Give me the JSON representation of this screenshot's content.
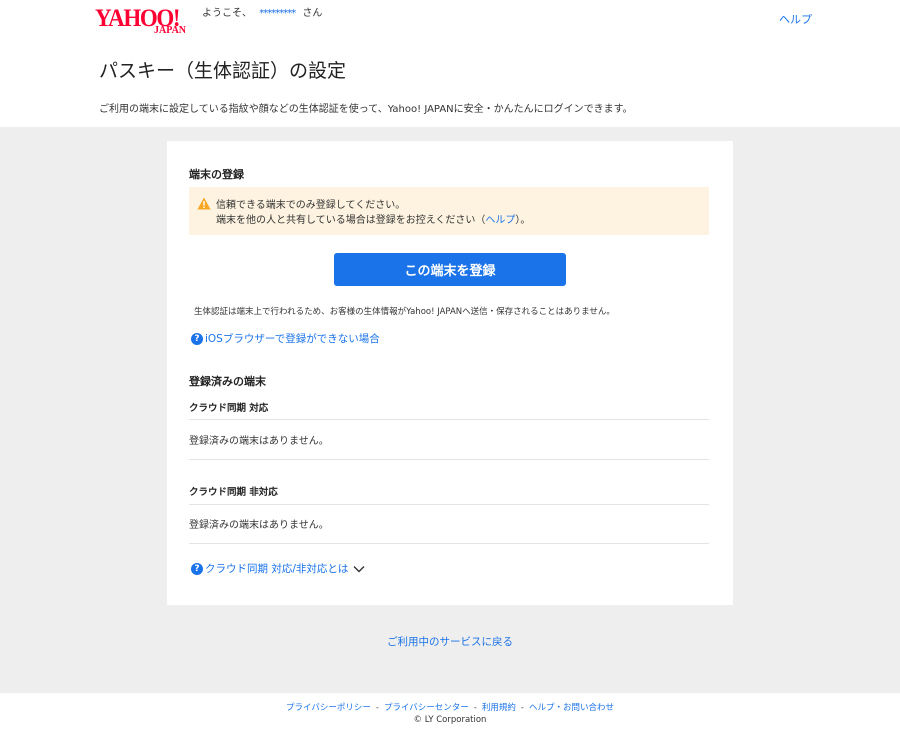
{
  "header": {
    "logo_main": "YAHOO!",
    "logo_sub": "JAPAN",
    "welcome_prefix": "ようこそ、",
    "username": "*********",
    "welcome_suffix": "さん",
    "help": "ヘルプ"
  },
  "page": {
    "title": "パスキー（生体認証）の設定",
    "description": "ご利用の端末に設定している指紋や顔などの生体認証を使って、Yahoo! JAPANに安全・かんたんにログインできます。"
  },
  "register": {
    "heading": "端末の登録",
    "warning_line1": "信頼できる端末でのみ登録してください。",
    "warning_line2_prefix": "端末を他の人と共有している場合は登録をお控えください（",
    "warning_line2_link": "ヘルプ",
    "warning_line2_suffix": "）。",
    "button": "この端末を登録",
    "note": "生体認証は端末上で行われるため、お客様の生体情報がYahoo! JAPANへ送信・保存されることはありません。",
    "ios_link": "iOSブラウザーで登録ができない場合"
  },
  "registered": {
    "heading": "登録済みの端末",
    "sync_heading": "クラウド同期 対応",
    "sync_empty": "登録済みの端末はありません。",
    "nosync_heading": "クラウド同期 非対応",
    "nosync_empty": "登録済みの端末はありません。",
    "about_link": "クラウド同期 対応/非対応とは"
  },
  "back_link": "ご利用中のサービスに戻る",
  "footer": {
    "links": [
      "プライバシーポリシー",
      "プライバシーセンター",
      "利用規約",
      "ヘルプ・お問い合わせ"
    ],
    "separator": "-",
    "copyright": "© LY Corporation"
  },
  "colors": {
    "brand": "#ff0033",
    "accent": "#1a73e8",
    "warning_bg": "#fdf3e0",
    "warning_icon": "#f5a623",
    "band_bg": "#eeeeee"
  },
  "icons": {
    "warning": "warning-icon",
    "help": "question-circle-icon",
    "expand": "chevron-down-icon"
  }
}
